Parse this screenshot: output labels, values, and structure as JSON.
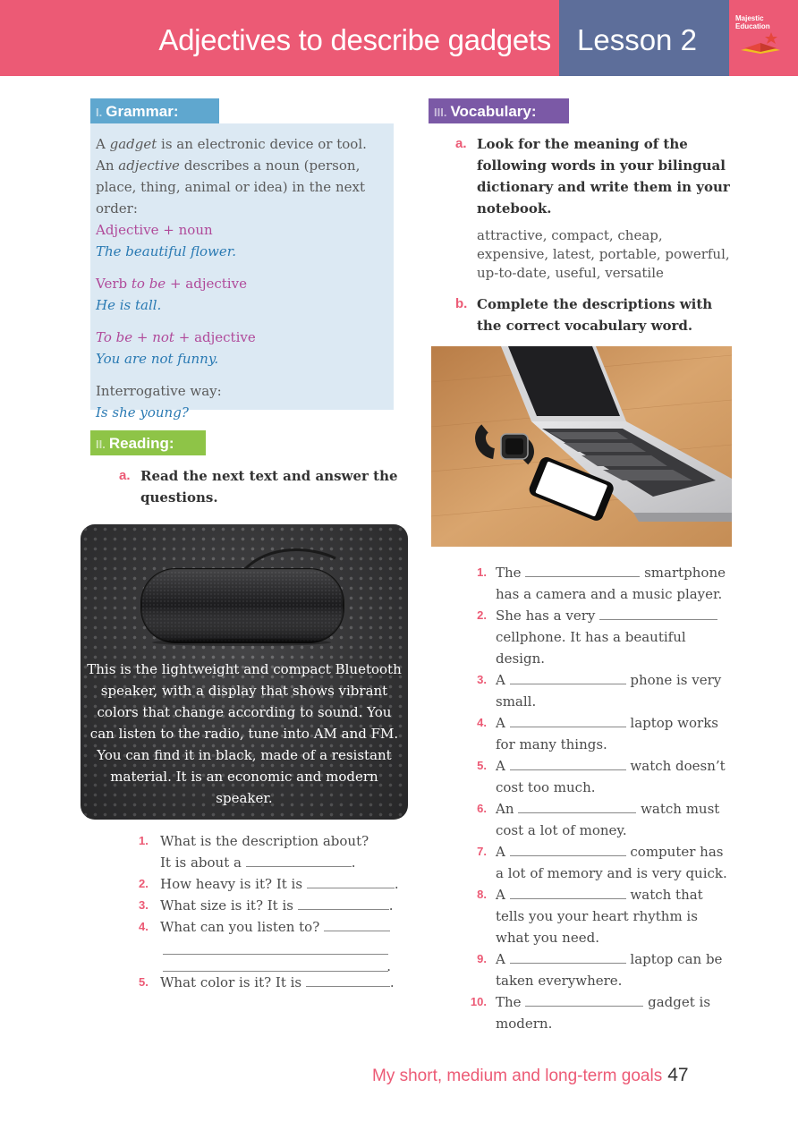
{
  "header": {
    "title": "Adjectives to describe gadgets",
    "lesson": "Lesson 2",
    "logo_line1": "Majestic",
    "logo_line2": "Education"
  },
  "grammar": {
    "num": "I.",
    "label": "Grammar:",
    "lines": {
      "l1a": "A ",
      "l1b": "gadget",
      "l1c": " is an electronic device or tool.",
      "l2a": "An ",
      "l2b": "adjective",
      "l2c": " describes a noun (person, place, thing, animal or idea) in the next order:",
      "rule1": "Adjective + noun",
      "ex1": "The beautiful flower.",
      "rule2a": "Verb ",
      "rule2b": "to be",
      "rule2c": " + adjective",
      "ex2": "He is tall.",
      "rule3a": "To be",
      "rule3b": " + ",
      "rule3c": "not",
      "rule3d": " + adjective",
      "ex3": "You are not funny.",
      "rule4": "Interrogative way:",
      "ex4": "Is she young?"
    }
  },
  "reading": {
    "num": "II.",
    "label": "Reading:",
    "instruction_letter": "a.",
    "instruction": "Read the next text and answer the questions.",
    "card_text": "This is the lightweight and compact Bluetooth speaker, with a display that shows vibrant colors that change according to sound. You can listen to the radio, tune into AM and FM. You can find it in black, made of a resistant material. It is an economic and modern speaker.",
    "questions": [
      {
        "n": "1.",
        "text": "What is the description about?",
        "text2": "It is about a",
        "end": "."
      },
      {
        "n": "2.",
        "text": "How heavy is it? It is",
        "end": "."
      },
      {
        "n": "3.",
        "text": "What size is it? It is",
        "end": "."
      },
      {
        "n": "4.",
        "text": "What can you listen to?",
        "end": "."
      },
      {
        "n": "5.",
        "text": "What color is it? It is",
        "end": "."
      }
    ]
  },
  "vocabulary": {
    "num": "III.",
    "label": "Vocabulary:",
    "a_letter": "a.",
    "a_text": "Look for the meaning of the following words in your bilingual dictionary and write them in your notebook.",
    "words": "attractive, compact, cheap, expensive, latest, portable, powerful, up-to-date, useful, versatile",
    "b_letter": "b.",
    "b_text": "Complete the descriptions with the correct vocabulary word.",
    "items": [
      {
        "n": "1.",
        "pre": "The",
        "post": "smartphone has a camera and a music player."
      },
      {
        "n": "2.",
        "pre": "She has a very",
        "post": "cellphone. It has a beautiful design."
      },
      {
        "n": "3.",
        "pre": "A",
        "post": "phone is very small."
      },
      {
        "n": "4.",
        "pre": "A",
        "post": "laptop works for many things."
      },
      {
        "n": "5.",
        "pre": "A",
        "post": "watch doesn’t cost too much."
      },
      {
        "n": "6.",
        "pre": "An",
        "post": "watch must cost a lot of money."
      },
      {
        "n": "7.",
        "pre": "A",
        "post": "computer has a lot of memory and is very quick."
      },
      {
        "n": "8.",
        "pre": "A",
        "post": "watch that tells you your heart rhythm is what you need."
      },
      {
        "n": "9.",
        "pre": "A",
        "post": "laptop can be taken everywhere."
      },
      {
        "n": "10.",
        "pre": "The",
        "post": "gadget is modern."
      }
    ]
  },
  "footer": {
    "text": "My short, medium and long-term goals",
    "page": "47"
  },
  "colors": {
    "header_pink": "#ec5a75",
    "lesson_blue": "#5d6e9a",
    "grammar_blue": "#5fa7cf",
    "reading_green": "#8ec447",
    "vocab_purple": "#7b59a6"
  }
}
